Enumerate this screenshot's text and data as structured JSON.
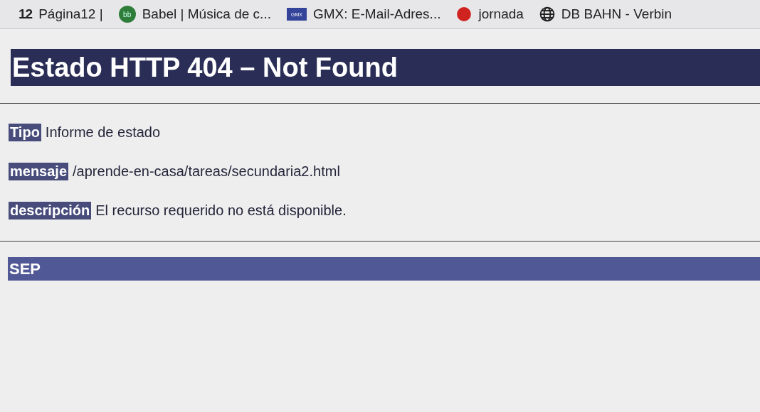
{
  "bookmarks": [
    {
      "kind": "text-logo",
      "logo": "12",
      "label": "Página12 |"
    },
    {
      "kind": "green-circle",
      "logo": "bb",
      "label": "Babel | Música de c..."
    },
    {
      "kind": "blue-square",
      "logo": "GMX",
      "label": "GMX: E-Mail-Adres..."
    },
    {
      "kind": "red-circle",
      "label": "jornada"
    },
    {
      "kind": "globe",
      "label": "DB BAHN - Verbin"
    }
  ],
  "title": "Estado HTTP 404 – Not Found",
  "fields": [
    {
      "label": "Tipo",
      "value": "Informe de estado"
    },
    {
      "label": "mensaje",
      "value": "/aprende-en-casa/tareas/secundaria2.html"
    },
    {
      "label": "descripción",
      "value": "El recurso requerido no está disponible."
    }
  ],
  "footer": "SEP"
}
